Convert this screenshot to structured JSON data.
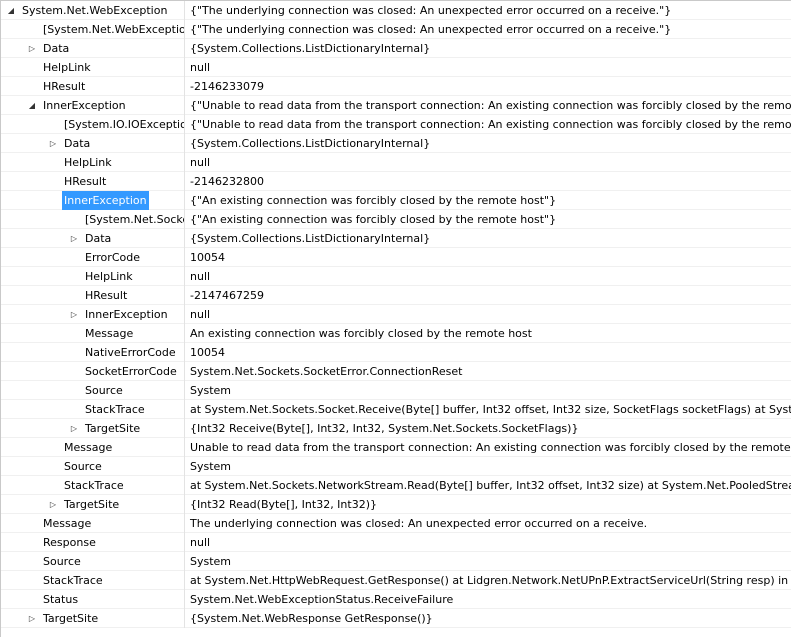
{
  "rows": [
    {
      "name": "System.Net.WebException",
      "value": "{\"The underlying connection was closed: An unexpected error occurred on a receive.\"}",
      "depth": 0,
      "expander": "expanded"
    },
    {
      "name": "[System.Net.WebException]",
      "value": "{\"The underlying connection was closed: An unexpected error occurred on a receive.\"}",
      "depth": 1,
      "expander": "none"
    },
    {
      "name": "Data",
      "value": "{System.Collections.ListDictionaryInternal}",
      "depth": 1,
      "expander": "collapsed"
    },
    {
      "name": "HelpLink",
      "value": "null",
      "depth": 1,
      "expander": "none"
    },
    {
      "name": "HResult",
      "value": "-2146233079",
      "depth": 1,
      "expander": "none"
    },
    {
      "name": "InnerException",
      "value": "{\"Unable to read data from the transport connection: An existing connection was forcibly closed by the remote ho",
      "depth": 1,
      "expander": "expanded"
    },
    {
      "name": "[System.IO.IOException]",
      "value": "{\"Unable to read data from the transport connection: An existing connection was forcibly closed by the remote ho",
      "depth": 2,
      "expander": "none"
    },
    {
      "name": "Data",
      "value": "{System.Collections.ListDictionaryInternal}",
      "depth": 2,
      "expander": "collapsed"
    },
    {
      "name": "HelpLink",
      "value": "null",
      "depth": 2,
      "expander": "none"
    },
    {
      "name": "HResult",
      "value": "-2146232800",
      "depth": 2,
      "expander": "none"
    },
    {
      "name": "InnerException",
      "value": "{\"An existing connection was forcibly closed by the remote host\"}",
      "depth": 2,
      "expander": "expanded",
      "selected": true
    },
    {
      "name": "[System.Net.Sockets.SocketException]",
      "value": "{\"An existing connection was forcibly closed by the remote host\"}",
      "depth": 3,
      "expander": "none"
    },
    {
      "name": "Data",
      "value": "{System.Collections.ListDictionaryInternal}",
      "depth": 3,
      "expander": "collapsed"
    },
    {
      "name": "ErrorCode",
      "value": "10054",
      "depth": 3,
      "expander": "none"
    },
    {
      "name": "HelpLink",
      "value": "null",
      "depth": 3,
      "expander": "none"
    },
    {
      "name": "HResult",
      "value": "-2147467259",
      "depth": 3,
      "expander": "none"
    },
    {
      "name": "InnerException",
      "value": "null",
      "depth": 3,
      "expander": "collapsed"
    },
    {
      "name": "Message",
      "value": "An existing connection was forcibly closed by the remote host",
      "depth": 3,
      "expander": "none"
    },
    {
      "name": "NativeErrorCode",
      "value": "10054",
      "depth": 3,
      "expander": "none"
    },
    {
      "name": "SocketErrorCode",
      "value": "System.Net.Sockets.SocketError.ConnectionReset",
      "depth": 3,
      "expander": "none"
    },
    {
      "name": "Source",
      "value": "System",
      "depth": 3,
      "expander": "none"
    },
    {
      "name": "StackTrace",
      "value": "  at System.Net.Sockets.Socket.Receive(Byte[] buffer, Int32 offset, Int32 size, SocketFlags socketFlags)   at System.N",
      "depth": 3,
      "expander": "none"
    },
    {
      "name": "TargetSite",
      "value": "{Int32 Receive(Byte[], Int32, Int32, System.Net.Sockets.SocketFlags)}",
      "depth": 3,
      "expander": "collapsed"
    },
    {
      "name": "Message",
      "value": "Unable to read data from the transport connection: An existing connection was forcibly closed by the remote hos",
      "depth": 2,
      "expander": "none"
    },
    {
      "name": "Source",
      "value": "System",
      "depth": 2,
      "expander": "none"
    },
    {
      "name": "StackTrace",
      "value": "  at System.Net.Sockets.NetworkStream.Read(Byte[] buffer, Int32 offset, Int32 size)   at System.Net.PooledStream.",
      "depth": 2,
      "expander": "none"
    },
    {
      "name": "TargetSite",
      "value": "{Int32 Read(Byte[], Int32, Int32)}",
      "depth": 2,
      "expander": "collapsed"
    },
    {
      "name": "Message",
      "value": "The underlying connection was closed: An unexpected error occurred on a receive.",
      "depth": 1,
      "expander": "none"
    },
    {
      "name": "Response",
      "value": "null",
      "depth": 1,
      "expander": "none"
    },
    {
      "name": "Source",
      "value": "System",
      "depth": 1,
      "expander": "none"
    },
    {
      "name": "StackTrace",
      "value": "  at System.Net.HttpWebRequest.GetResponse()   at Lidgren.Network.NetUPnP.ExtractServiceUrl(String resp) in C",
      "depth": 1,
      "expander": "none"
    },
    {
      "name": "Status",
      "value": "System.Net.WebExceptionStatus.ReceiveFailure",
      "depth": 1,
      "expander": "none"
    },
    {
      "name": "TargetSite",
      "value": "{System.Net.WebResponse GetResponse()}",
      "depth": 1,
      "expander": "collapsed"
    }
  ],
  "icons": {
    "expanded": "◢",
    "collapsed": "▷",
    "none": ""
  },
  "colors": {
    "selection": "#3399ff",
    "grid_line": "#f0f0f0"
  }
}
